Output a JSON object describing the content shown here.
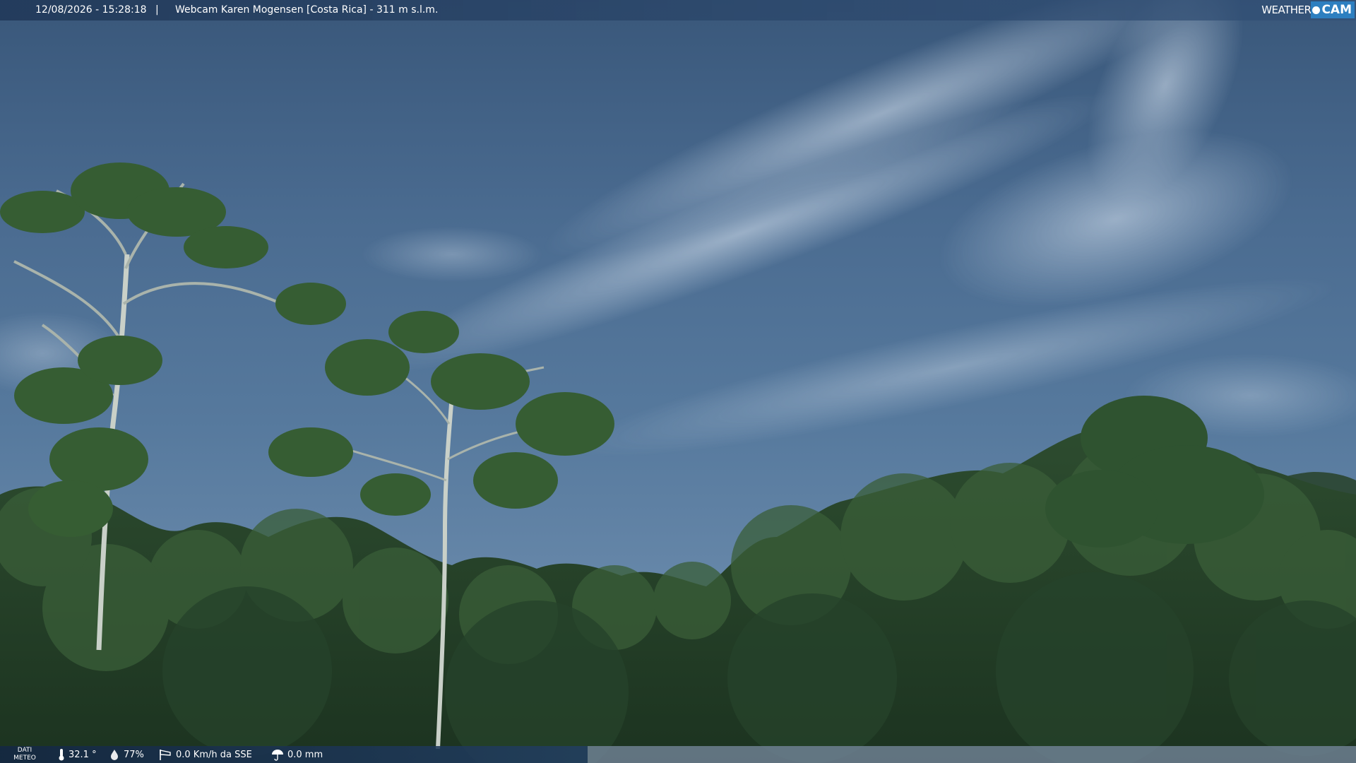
{
  "overlay": {
    "datetime": "12/08/2026 - 15:28:18",
    "separator": "|",
    "title": "Webcam Karen Mogensen [Costa Rica]  - 311 m s.l.m."
  },
  "logo": {
    "part1": "WEATHER",
    "part2": "CAM"
  },
  "meteo": {
    "label_line1": "DATI",
    "label_line2": "METEO",
    "temperature": "32.1 °",
    "humidity": "77%",
    "wind": "0.0 Km/h da SSE",
    "rain": "0.0 mm"
  },
  "icons": {
    "temperature": "thermometer-icon",
    "humidity": "drop-icon",
    "wind": "windsock-icon",
    "rain": "umbrella-icon"
  }
}
